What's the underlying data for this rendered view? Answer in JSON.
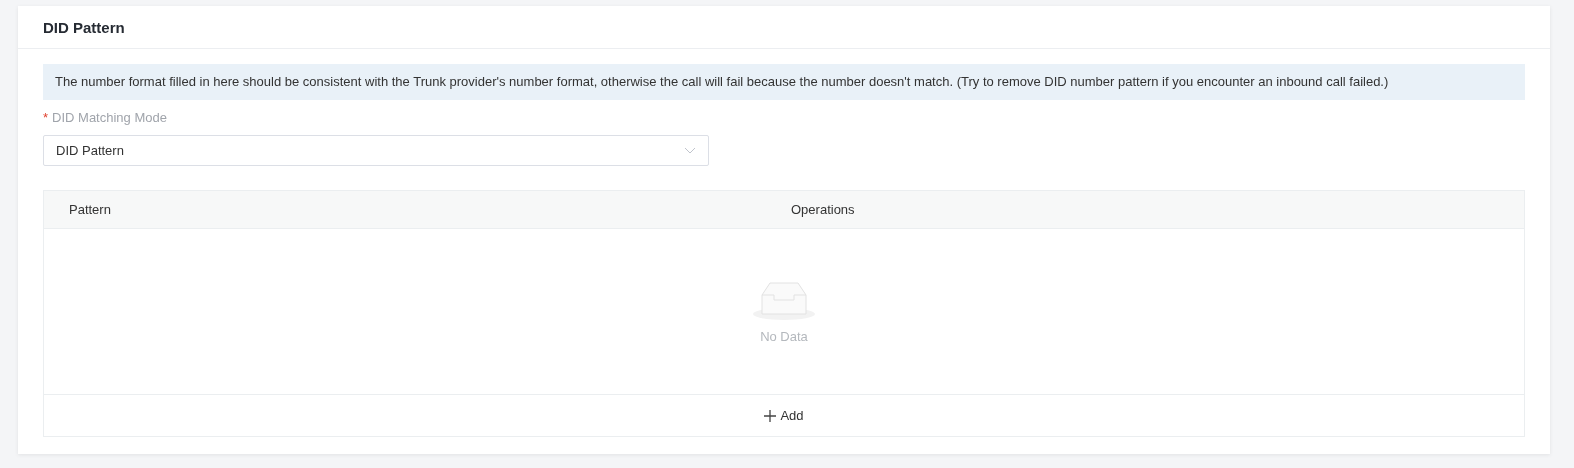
{
  "card": {
    "title": "DID Pattern"
  },
  "notice": "The number format filled in here should be consistent with the Trunk provider's number format, otherwise the call will fail because the number doesn't match. (Try to remove DID number pattern if you encounter an inbound call failed.)",
  "field": {
    "label": "DID Matching Mode",
    "required_mark": "*",
    "value": "DID Pattern"
  },
  "table": {
    "columns": [
      "Pattern",
      "Operations"
    ],
    "empty_text": "No Data",
    "add_button": "Add"
  }
}
